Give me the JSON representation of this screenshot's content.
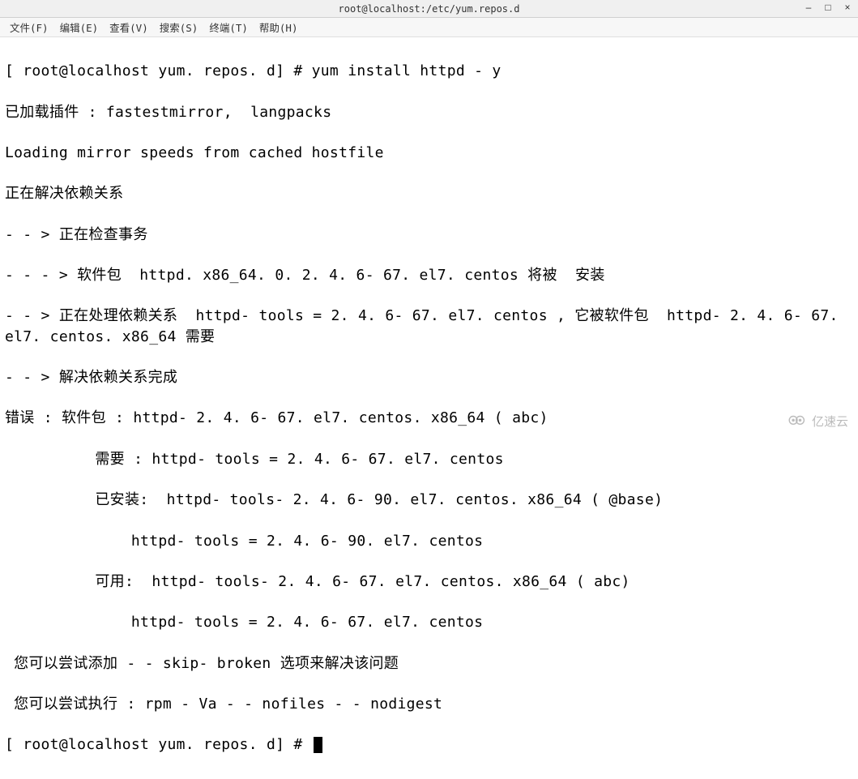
{
  "window": {
    "title": "root@localhost:/etc/yum.repos.d",
    "controls": {
      "minimize": "–",
      "maximize": "□",
      "close": "×"
    }
  },
  "menubar": {
    "items": [
      "文件(F)",
      "编辑(E)",
      "查看(V)",
      "搜索(S)",
      "终端(T)",
      "帮助(H)"
    ]
  },
  "terminal": {
    "lines": [
      "[ root@localhost yum. repos. d] # yum install httpd - y",
      "已加载插件 : fastestmirror,  langpacks",
      "Loading mirror speeds from cached hostfile",
      "正在解决依赖关系",
      "- - > 正在检查事务",
      "- - - > 软件包  httpd. x86_64. 0. 2. 4. 6- 67. el7. centos 将被  安装",
      "- - > 正在处理依赖关系  httpd- tools = 2. 4. 6- 67. el7. centos , 它被软件包  httpd- 2. 4. 6- 67. el7. centos. x86_64 需要",
      "- - > 解决依赖关系完成",
      "错误 : 软件包 : httpd- 2. 4. 6- 67. el7. centos. x86_64 ( abc)",
      "          需要 : httpd- tools = 2. 4. 6- 67. el7. centos",
      "          已安装:  httpd- tools- 2. 4. 6- 90. el7. centos. x86_64 ( @base)",
      "              httpd- tools = 2. 4. 6- 90. el7. centos",
      "          可用:  httpd- tools- 2. 4. 6- 67. el7. centos. x86_64 ( abc)",
      "              httpd- tools = 2. 4. 6- 67. el7. centos",
      " 您可以尝试添加 - - skip- broken 选项来解决该问题",
      " 您可以尝试执行 : rpm - Va - - nofiles - - nodigest"
    ],
    "prompt": "[ root@localhost yum. repos. d] # "
  },
  "watermark": {
    "text": "亿速云"
  }
}
